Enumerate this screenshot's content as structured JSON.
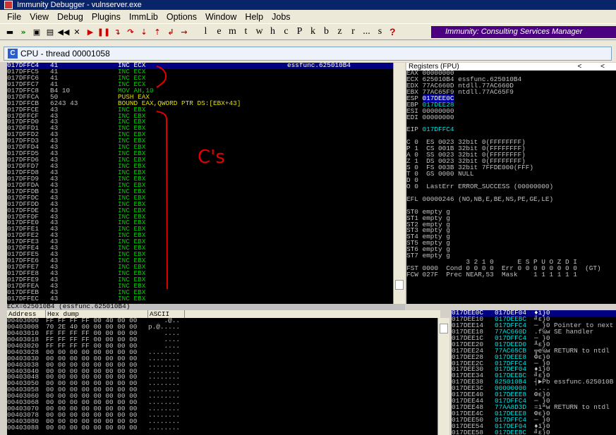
{
  "window": {
    "title": "Immunity Debugger - vulnserver.exe"
  },
  "menu": [
    "File",
    "View",
    "Debug",
    "Plugins",
    "ImmLib",
    "Options",
    "Window",
    "Help",
    "Jobs"
  ],
  "toolbar": {
    "letters": [
      "l",
      "e",
      "m",
      "t",
      "w",
      "h",
      "c",
      "P",
      "k",
      "b",
      "z",
      "r",
      "...",
      "s"
    ],
    "help": "?",
    "brand": "Immunity: Consulting Services Manager"
  },
  "cpu_window": {
    "title": "CPU - thread 00001058",
    "icon_letter": "C"
  },
  "disasm": {
    "rows": [
      {
        "addr": "017DFFC4",
        "hex": "41",
        "instr": "INC ECX",
        "comment": "essfunc.625010B4",
        "kind": "g",
        "selected": true
      },
      {
        "addr": "017DFFC5",
        "hex": "41",
        "instr": "INC ECX",
        "comment": "",
        "kind": "g"
      },
      {
        "addr": "017DFFC6",
        "hex": "41",
        "instr": "INC ECX",
        "comment": "",
        "kind": "g"
      },
      {
        "addr": "017DFFC7",
        "hex": "41",
        "instr": "INC ECX",
        "comment": "",
        "kind": "g"
      },
      {
        "addr": "017DFFC8",
        "hex": "B4 10",
        "instr": "MOV AH,10",
        "comment": "",
        "kind": "g"
      },
      {
        "addr": "017DFFCA",
        "hex": "50",
        "instr": "PUSH EAX",
        "comment": "",
        "kind": "y"
      },
      {
        "addr": "017DFFCB",
        "hex": "6243 43",
        "instr": "BOUND EAX,QWORD PTR DS:[EBX+43]",
        "comment": "",
        "kind": "y"
      },
      {
        "addr": "017DFFCE",
        "hex": "43",
        "instr": "INC EBX",
        "comment": "",
        "kind": "g"
      },
      {
        "addr": "017DFFCF",
        "hex": "43",
        "instr": "INC EBX",
        "comment": "",
        "kind": "g"
      },
      {
        "addr": "017DFFD0",
        "hex": "43",
        "instr": "INC EBX",
        "comment": "",
        "kind": "g"
      },
      {
        "addr": "017DFFD1",
        "hex": "43",
        "instr": "INC EBX",
        "comment": "",
        "kind": "g"
      },
      {
        "addr": "017DFFD2",
        "hex": "43",
        "instr": "INC EBX",
        "comment": "",
        "kind": "g"
      },
      {
        "addr": "017DFFD3",
        "hex": "43",
        "instr": "INC EBX",
        "comment": "",
        "kind": "g"
      },
      {
        "addr": "017DFFD4",
        "hex": "43",
        "instr": "INC EBX",
        "comment": "",
        "kind": "g"
      },
      {
        "addr": "017DFFD5",
        "hex": "43",
        "instr": "INC EBX",
        "comment": "",
        "kind": "g"
      },
      {
        "addr": "017DFFD6",
        "hex": "43",
        "instr": "INC EBX",
        "comment": "",
        "kind": "g"
      },
      {
        "addr": "017DFFD7",
        "hex": "43",
        "instr": "INC EBX",
        "comment": "",
        "kind": "g"
      },
      {
        "addr": "017DFFD8",
        "hex": "43",
        "instr": "INC EBX",
        "comment": "",
        "kind": "g"
      },
      {
        "addr": "017DFFD9",
        "hex": "43",
        "instr": "INC EBX",
        "comment": "",
        "kind": "g"
      },
      {
        "addr": "017DFFDA",
        "hex": "43",
        "instr": "INC EBX",
        "comment": "",
        "kind": "g"
      },
      {
        "addr": "017DFFDB",
        "hex": "43",
        "instr": "INC EBX",
        "comment": "",
        "kind": "g"
      },
      {
        "addr": "017DFFDC",
        "hex": "43",
        "instr": "INC EBX",
        "comment": "",
        "kind": "g"
      },
      {
        "addr": "017DFFDD",
        "hex": "43",
        "instr": "INC EBX",
        "comment": "",
        "kind": "g"
      },
      {
        "addr": "017DFFDE",
        "hex": "43",
        "instr": "INC EBX",
        "comment": "",
        "kind": "g"
      },
      {
        "addr": "017DFFDF",
        "hex": "43",
        "instr": "INC EBX",
        "comment": "",
        "kind": "g"
      },
      {
        "addr": "017DFFE0",
        "hex": "43",
        "instr": "INC EBX",
        "comment": "",
        "kind": "g"
      },
      {
        "addr": "017DFFE1",
        "hex": "43",
        "instr": "INC EBX",
        "comment": "",
        "kind": "g"
      },
      {
        "addr": "017DFFE2",
        "hex": "43",
        "instr": "INC EBX",
        "comment": "",
        "kind": "g"
      },
      {
        "addr": "017DFFE3",
        "hex": "43",
        "instr": "INC EBX",
        "comment": "",
        "kind": "g"
      },
      {
        "addr": "017DFFE4",
        "hex": "43",
        "instr": "INC EBX",
        "comment": "",
        "kind": "g"
      },
      {
        "addr": "017DFFE5",
        "hex": "43",
        "instr": "INC EBX",
        "comment": "",
        "kind": "g"
      },
      {
        "addr": "017DFFE6",
        "hex": "43",
        "instr": "INC EBX",
        "comment": "",
        "kind": "g"
      },
      {
        "addr": "017DFFE7",
        "hex": "43",
        "instr": "INC EBX",
        "comment": "",
        "kind": "g"
      },
      {
        "addr": "017DFFE8",
        "hex": "43",
        "instr": "INC EBX",
        "comment": "",
        "kind": "g"
      },
      {
        "addr": "017DFFE9",
        "hex": "43",
        "instr": "INC EBX",
        "comment": "",
        "kind": "g"
      },
      {
        "addr": "017DFFEA",
        "hex": "43",
        "instr": "INC EBX",
        "comment": "",
        "kind": "g"
      },
      {
        "addr": "017DFFEB",
        "hex": "43",
        "instr": "INC EBX",
        "comment": "",
        "kind": "g"
      },
      {
        "addr": "017DFFEC",
        "hex": "43",
        "instr": "INC EBX",
        "comment": "",
        "kind": "g"
      }
    ],
    "info_line": "ECX=625010B4 (essfunc.625010B4)"
  },
  "annotation": {
    "text": "C's",
    "color": "#e00000"
  },
  "registers": {
    "title": "Registers (FPU)",
    "nav": [
      "<",
      "<"
    ],
    "lines": [
      {
        "t": "EAX 00000000"
      },
      {
        "t": "ECX 625010B4 essfunc.625010B4"
      },
      {
        "t": "EDX 77AC660D ntdll.77AC660D"
      },
      {
        "t": "EBX 77AC65F9 ntdll.77AC65F9"
      },
      {
        "t": "ESP ",
        "v": "017DEE0C",
        "hl": true
      },
      {
        "t": "EBP ",
        "v": "017DEE28",
        "cy": true
      },
      {
        "t": "ESI 00000000"
      },
      {
        "t": "EDI 00000000"
      },
      {
        "t": ""
      },
      {
        "t": "EIP ",
        "v": "017DFFC4",
        "cy": true
      },
      {
        "t": ""
      },
      {
        "t": "C 0  ES 0023 32bit 0(FFFFFFFF)"
      },
      {
        "t": "P 1  CS 001B 32bit 0(FFFFFFFF)"
      },
      {
        "t": "A 0  SS 0023 32bit 0(FFFFFFFF)"
      },
      {
        "t": "Z 1  DS 0023 32bit 0(FFFFFFFF)"
      },
      {
        "t": "S 0  FS 003B 32bit 7FFDE000(FFF)"
      },
      {
        "t": "T 0  GS 0000 NULL"
      },
      {
        "t": "D 0"
      },
      {
        "t": "O 0  LastErr ERROR_SUCCESS (00000000)"
      },
      {
        "t": ""
      },
      {
        "t": "EFL 00000246 (NO,NB,E,BE,NS,PE,GE,LE)"
      },
      {
        "t": ""
      },
      {
        "t": "ST0 empty g"
      },
      {
        "t": "ST1 empty g"
      },
      {
        "t": "ST2 empty g"
      },
      {
        "t": "ST3 empty g"
      },
      {
        "t": "ST4 empty g"
      },
      {
        "t": "ST5 empty g"
      },
      {
        "t": "ST6 empty g"
      },
      {
        "t": "ST7 empty g"
      },
      {
        "t": "               3 2 1 0      E S P U O Z D I"
      },
      {
        "t": "FST 0000  Cond 0 0 0 0  Err 0 0 0 0 0 0 0 0  (GT)"
      },
      {
        "t": "FCW 027F  Prec NEAR,53  Mask    1 1 1 1 1 1"
      }
    ]
  },
  "dump": {
    "headers": [
      "Address",
      "Hex dump",
      "ASCII"
    ],
    "rows": [
      {
        "addr": "00403000",
        "hex": "FF FF FF FF 00 40 00 00",
        "ascii": "    .@.."
      },
      {
        "addr": "00403008",
        "hex": "70 2E 40 00 00 00 00 00",
        "ascii": "p.@....."
      },
      {
        "addr": "00403010",
        "hex": "FF FF FF FF 00 00 00 00",
        "ascii": "    ...."
      },
      {
        "addr": "00403018",
        "hex": "FF FF FF FF 00 00 00 00",
        "ascii": "    ...."
      },
      {
        "addr": "00403020",
        "hex": "FF FF FF FF 00 00 00 00",
        "ascii": "    ...."
      },
      {
        "addr": "00403028",
        "hex": "00 00 00 00 00 00 00 00",
        "ascii": "........"
      },
      {
        "addr": "00403030",
        "hex": "00 00 00 00 00 00 00 00",
        "ascii": "........"
      },
      {
        "addr": "00403038",
        "hex": "00 00 00 00 00 00 00 00",
        "ascii": "........"
      },
      {
        "addr": "00403040",
        "hex": "00 00 00 00 00 00 00 00",
        "ascii": "........"
      },
      {
        "addr": "00403048",
        "hex": "00 00 00 00 00 00 00 00",
        "ascii": "........"
      },
      {
        "addr": "00403050",
        "hex": "00 00 00 00 00 00 00 00",
        "ascii": "........"
      },
      {
        "addr": "00403058",
        "hex": "00 00 00 00 00 00 00 00",
        "ascii": "........"
      },
      {
        "addr": "00403060",
        "hex": "00 00 00 00 00 00 00 00",
        "ascii": "........"
      },
      {
        "addr": "00403068",
        "hex": "00 00 00 00 00 00 00 00",
        "ascii": "........"
      },
      {
        "addr": "00403070",
        "hex": "00 00 00 00 00 00 00 00",
        "ascii": "........"
      },
      {
        "addr": "00403078",
        "hex": "00 00 00 00 00 00 00 00",
        "ascii": "........"
      },
      {
        "addr": "00403080",
        "hex": "00 00 00 00 00 00 00 00",
        "ascii": "........"
      },
      {
        "addr": "00403088",
        "hex": "00 00 00 00 00 00 00 00",
        "ascii": "........"
      }
    ]
  },
  "stack": {
    "rows": [
      {
        "addr": "017DEE0C",
        "val": "017DEF04",
        "asc": "♦ï}0",
        "comment": ""
      },
      {
        "addr": "017DEE10",
        "val": "017DEEBC",
        "asc": "╝ε}0",
        "comment": ""
      },
      {
        "addr": "017DEE14",
        "val": "017DFFC4",
        "asc": "─ }0",
        "comment": "Pointer to next"
      },
      {
        "addr": "017DEE18",
        "val": "77AC660D",
        "asc": ".f¼w",
        "comment": "SE handler"
      },
      {
        "addr": "017DEE1C",
        "val": "017DFFC4",
        "asc": "─ }0",
        "comment": ""
      },
      {
        "addr": "017DEE20",
        "val": "017DEED0",
        "asc": "╨ε}0",
        "comment": ""
      },
      {
        "addr": "017DEE24",
        "val": "77AC65CB",
        "asc": "╦e¼w",
        "comment": "RETURN to ntdl"
      },
      {
        "addr": "017DEE28",
        "val": "017DEEE8",
        "asc": "Φε}0",
        "comment": ""
      },
      {
        "addr": "017DEE2C",
        "val": "017DFFC4",
        "asc": "─ }0",
        "comment": ""
      },
      {
        "addr": "017DEE30",
        "val": "017DEF04",
        "asc": "♦ï}0",
        "comment": ""
      },
      {
        "addr": "017DEE34",
        "val": "017DEEBC",
        "asc": "╝ε}0",
        "comment": ""
      },
      {
        "addr": "017DEE38",
        "val": "625010B4",
        "asc": "┤►Pb",
        "comment": "essfunc.625010B"
      },
      {
        "addr": "017DEE3C",
        "val": "00000000",
        "asc": "....",
        "comment": ""
      },
      {
        "addr": "017DEE40",
        "val": "017DEEE8",
        "asc": "Φε}0",
        "comment": ""
      },
      {
        "addr": "017DEE44",
        "val": "017DFFC4",
        "asc": "─ }0",
        "comment": ""
      },
      {
        "addr": "017DEE48",
        "val": "77AA8D3D",
        "asc": "=ìªw",
        "comment": "RETURN to ntdl"
      },
      {
        "addr": "017DEE4C",
        "val": "017DEEE8",
        "asc": "Φε}0",
        "comment": ""
      },
      {
        "addr": "017DEE50",
        "val": "017DFFC4",
        "asc": "─ }0",
        "comment": ""
      },
      {
        "addr": "017DEE54",
        "val": "017DEF04",
        "asc": "♦ï}0",
        "comment": ""
      },
      {
        "addr": "017DEE58",
        "val": "017DEEBC",
        "asc": "╝ε}0",
        "comment": ""
      }
    ]
  }
}
